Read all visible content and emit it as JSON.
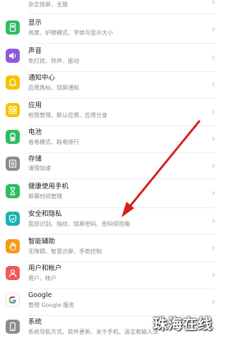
{
  "top_item": {
    "subtitle": "杂志锁屏、主题"
  },
  "items": [
    {
      "id": "display",
      "title": "显示",
      "subtitle": "亮度、护眼模式、字体与显示大小",
      "icon": "display-icon",
      "color": "#2ebd62"
    },
    {
      "id": "sound",
      "title": "声音",
      "subtitle": "免打扰、铃声、振动",
      "icon": "speaker-icon",
      "color": "#8e59e0"
    },
    {
      "id": "notification",
      "title": "通知中心",
      "subtitle": "应用角标、锁屏通知",
      "icon": "bell-icon",
      "color": "#f5c300"
    },
    {
      "id": "apps",
      "title": "应用",
      "subtitle": "权限管理、默认应用、应用分身",
      "icon": "apps-grid-icon",
      "color": "#f5c300"
    },
    {
      "id": "battery",
      "title": "电池",
      "subtitle": "省电模式、耗电排行",
      "icon": "battery-icon",
      "color": "#2ebd62"
    },
    {
      "id": "storage",
      "title": "存储",
      "subtitle": "清理加速",
      "icon": "storage-icon",
      "color": "#8c8c8c"
    },
    {
      "id": "digital-balance",
      "title": "健康使用手机",
      "subtitle": "屏幕时间管理",
      "icon": "hourglass-icon",
      "color": "#2ebd62"
    },
    {
      "id": "security",
      "title": "安全和隐私",
      "subtitle": "面部识别、指纹、锁屏密码、密码保险箱",
      "icon": "shield-check-icon",
      "color": "#14b3b3"
    },
    {
      "id": "accessibility",
      "title": "智能辅助",
      "subtitle": "无障碍、智慧识屏、手势控制",
      "icon": "hand-icon",
      "color": "#f39c18"
    },
    {
      "id": "accounts",
      "title": "用户和帐户",
      "subtitle": "用户、帐户",
      "icon": "user-icon",
      "color": "#f05a5a"
    },
    {
      "id": "google",
      "title": "Google",
      "subtitle": "管理 Google 服务",
      "icon": "google-icon",
      "color": "#ffffff"
    },
    {
      "id": "system",
      "title": "系统",
      "subtitle": "系统导航方式、软件更新、关于手机、语言和输入法",
      "icon": "phone-icon",
      "color": "#8c8c8c"
    }
  ],
  "annotation_color": "#d61f1f",
  "watermark": "珠海在线"
}
